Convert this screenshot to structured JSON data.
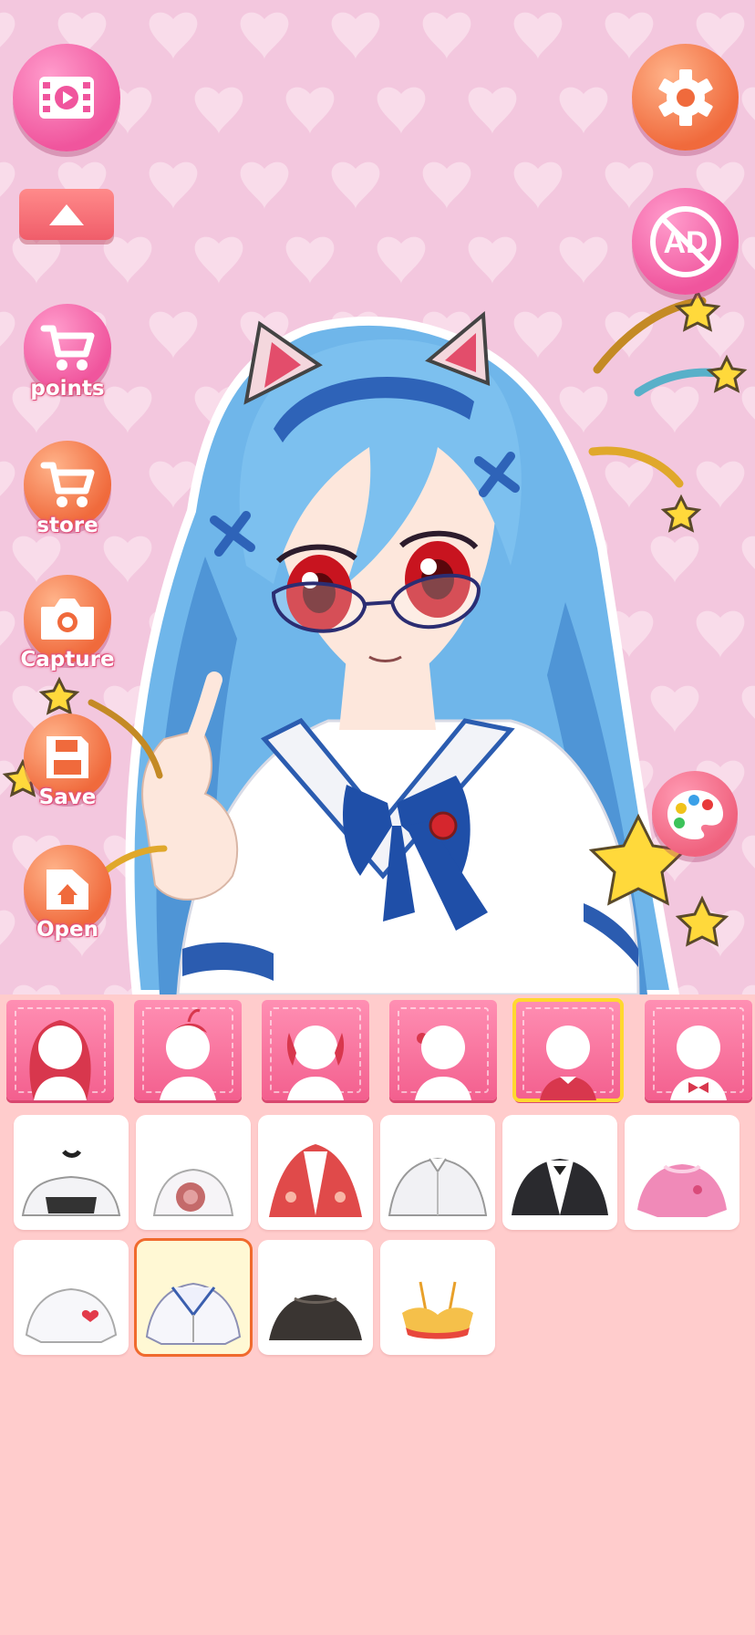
{
  "colors": {
    "background": "#f3c7de",
    "panel": "#ffcccc",
    "button_pink": "#f0559d",
    "button_orange": "#f06a3c",
    "selected_outline": "#ffd82f",
    "selected_item_outline": "#f06a2d"
  },
  "left_toolbar": {
    "video_button": {
      "icon": "video-film-icon"
    },
    "collapse_button": {
      "icon": "arrow-up-icon"
    },
    "points_button": {
      "icon": "cart-icon",
      "label": "points"
    },
    "store_button": {
      "icon": "cart-icon",
      "label": "store"
    },
    "capture_button": {
      "icon": "camera-icon",
      "label": "Capture"
    },
    "save_button": {
      "icon": "floppy-disk-icon",
      "label": "Save"
    },
    "open_button": {
      "icon": "folder-open-icon",
      "label": "Open"
    }
  },
  "right_toolbar": {
    "settings_button": {
      "icon": "gear-icon"
    },
    "remove_ads_button": {
      "icon": "no-ads-icon",
      "label": "AD"
    },
    "palette_button": {
      "icon": "palette-icon"
    }
  },
  "category_tabs": [
    {
      "name": "long-hair",
      "icon": "long-hair-head-icon",
      "selected": false
    },
    {
      "name": "front-hair",
      "icon": "front-hair-head-icon",
      "selected": false
    },
    {
      "name": "side-hair",
      "icon": "side-hair-head-icon",
      "selected": false
    },
    {
      "name": "hair-accessory",
      "icon": "head-silhouette-icon",
      "selected": false
    },
    {
      "name": "top",
      "icon": "top-shirt-head-icon",
      "selected": true
    },
    {
      "name": "neckwear",
      "icon": "bow-tie-head-icon",
      "selected": false
    }
  ],
  "items": [
    {
      "name": "maid-top",
      "icon": "maid-collar-top-icon",
      "selected": false
    },
    {
      "name": "rose-blouse",
      "icon": "rose-blouse-icon",
      "selected": false
    },
    {
      "name": "red-bear-cape",
      "icon": "red-cape-icon",
      "selected": false
    },
    {
      "name": "striped-shirt",
      "icon": "white-shirt-icon",
      "selected": false
    },
    {
      "name": "black-blazer",
      "icon": "black-blazer-icon",
      "selected": false
    },
    {
      "name": "pink-sweater",
      "icon": "pink-sweater-icon",
      "selected": false
    },
    {
      "name": "heart-tshirt",
      "icon": "heart-tshirt-icon",
      "selected": false
    },
    {
      "name": "sailor-shirt",
      "icon": "sailor-shirt-icon",
      "selected": true
    },
    {
      "name": "dark-top",
      "icon": "dark-top-icon",
      "selected": false
    },
    {
      "name": "frill-bikini",
      "icon": "bikini-top-icon",
      "selected": false
    }
  ]
}
